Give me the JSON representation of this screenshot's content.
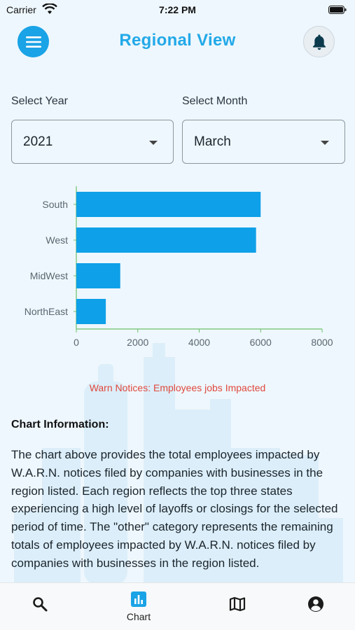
{
  "status_bar": {
    "carrier": "Carrier",
    "time": "7:22 PM"
  },
  "header": {
    "title": "Regional View",
    "menu_icon": "hamburger-menu-icon",
    "bell_icon": "bell-icon",
    "accent_color": "#1aa3e6"
  },
  "filters": {
    "year_label": "Select Year",
    "year_value": "2021",
    "month_label": "Select Month",
    "month_value": "March"
  },
  "chart_data": {
    "type": "bar",
    "orientation": "horizontal",
    "categories": [
      "South",
      "West",
      "MidWest",
      "NorthEast"
    ],
    "values": [
      6000,
      5850,
      1430,
      960
    ],
    "xlim": [
      0,
      8000
    ],
    "xticks": [
      "0",
      "2000",
      "4000",
      "6000",
      "8000"
    ],
    "bar_color": "#0ea0e8",
    "axis_color": "#6cc06c",
    "caption": "Warn Notices: Employees jobs Impacted"
  },
  "info": {
    "heading": "Chart Information:",
    "body": "The chart above provides the total employees impacted by W.A.R.N. notices filed by companies with businesses in the region listed. Each region reflects the top three states experiencing a high level of layoffs or closings for the selected period of time. The \"other\" category represents the remaining totals of employees impacted by W.A.R.N. notices filed by companies with businesses in the region listed."
  },
  "bottom_nav": {
    "items": [
      {
        "icon": "search-icon",
        "label": ""
      },
      {
        "icon": "bar-chart-icon",
        "label": "Chart"
      },
      {
        "icon": "map-icon",
        "label": ""
      },
      {
        "icon": "account-circle-icon",
        "label": ""
      }
    ]
  }
}
